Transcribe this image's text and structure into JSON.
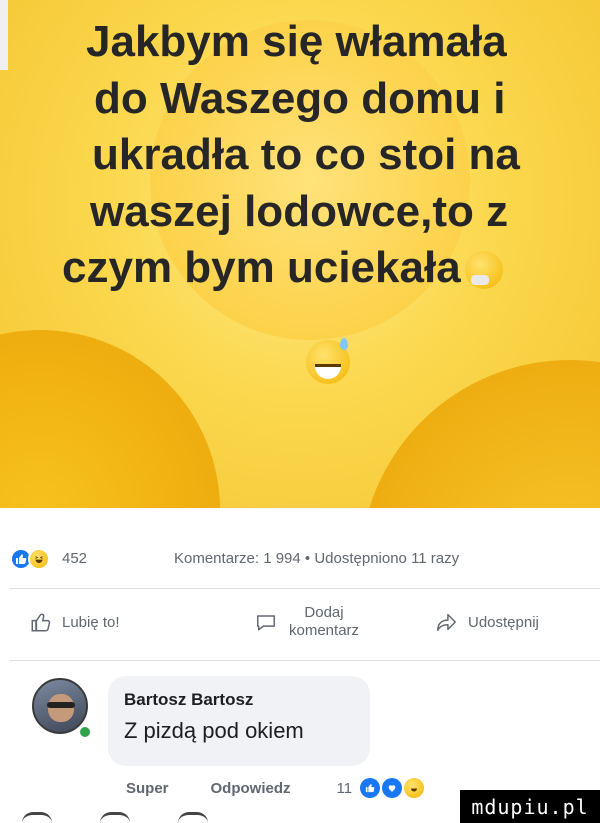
{
  "meme": {
    "caption_lines": [
      "Jakbym się włamała",
      "do Waszego domu i",
      "ukradła to co stoi na",
      "waszej lodowce,to z",
      "czym bym uciekała"
    ],
    "emoji_inline": "thinking-face-icon",
    "emoji_below": "grinning-sweat-icon"
  },
  "post_stats": {
    "reaction_icons": [
      "like-icon",
      "haha-icon"
    ],
    "reaction_count": "452",
    "comments_shares": "Komentarze: 1 994 • Udostępniono 11 razy"
  },
  "actions": {
    "like": "Lubię to!",
    "comment_line1": "Dodaj",
    "comment_line2": "komentarz",
    "share": "Udostępnij"
  },
  "comment": {
    "author": "Bartosz Bartosz",
    "text": "Z pizdą pod okiem",
    "like_label": "Super",
    "reply_label": "Odpowiedz",
    "reaction_count": "11",
    "reaction_icons": [
      "like-icon",
      "love-icon",
      "haha-icon"
    ]
  },
  "watermark": "mdupiu.pl",
  "colors": {
    "meme_background": "#fbd84e",
    "caption_text": "#262626",
    "facebook_blue": "#1877f2",
    "secondary_text": "#606770",
    "bubble_background": "#f0f2f5",
    "online_green": "#31a24c"
  }
}
